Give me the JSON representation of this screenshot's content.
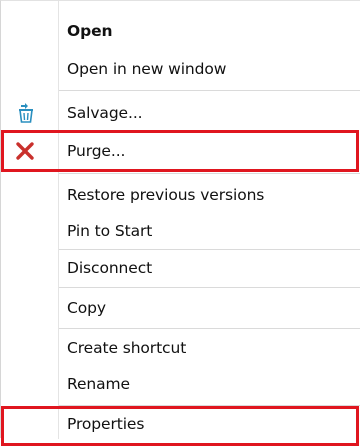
{
  "menu": {
    "items": [
      {
        "label": "Open"
      },
      {
        "label": "Open in new window"
      },
      {
        "label": "Salvage..."
      },
      {
        "label": "Purge..."
      },
      {
        "label": "Restore previous versions"
      },
      {
        "label": "Pin to Start"
      },
      {
        "label": "Disconnect"
      },
      {
        "label": "Copy"
      },
      {
        "label": "Create shortcut"
      },
      {
        "label": "Rename"
      },
      {
        "label": "Properties"
      }
    ],
    "icons": {
      "salvage": "salvage-icon",
      "purge": "purge-x-icon"
    }
  },
  "colors": {
    "highlight": "#e0161f",
    "separator": "#dadada",
    "salvage_icon": "#2a8fbf",
    "purge_icon": "#c9302c"
  }
}
